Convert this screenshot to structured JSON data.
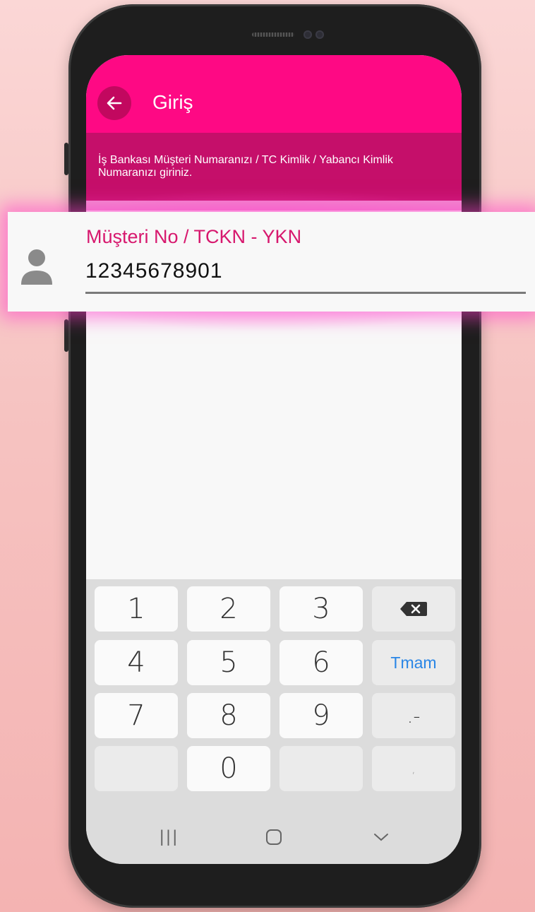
{
  "appbar": {
    "title": "Giriş",
    "back_icon": "arrow-left-icon"
  },
  "info": {
    "text": "İş Bankası Müşteri Numaranızı / TC Kimlik / Yabancı Kimlik Numaranızı giriniz."
  },
  "field": {
    "label": "Müşteri No / TCKN - YKN",
    "value": "12345678901",
    "icon": "person-icon"
  },
  "keyboard": {
    "rows": [
      [
        "1",
        "2",
        "3",
        "backspace"
      ],
      [
        "4",
        "5",
        "6",
        "Tmam"
      ],
      [
        "7",
        "8",
        "9",
        ".-"
      ],
      [
        "",
        "0",
        "",
        ","
      ]
    ],
    "done_label": "Tmam",
    "k1": "1",
    "k2": "2",
    "k3": "3",
    "k4": "4",
    "k5": "5",
    "k6": "6",
    "k7": "7",
    "k8": "8",
    "k9": "9",
    "k0": "0",
    "dotdash": ".-",
    "comma": ","
  },
  "navbar": {
    "recents": "|||",
    "home": "home-icon",
    "back": "chevron-down-icon"
  },
  "colors": {
    "accent": "#fe0984",
    "info_bg": "#c50f6a",
    "label": "#d7186e",
    "done": "#2a86e6"
  }
}
